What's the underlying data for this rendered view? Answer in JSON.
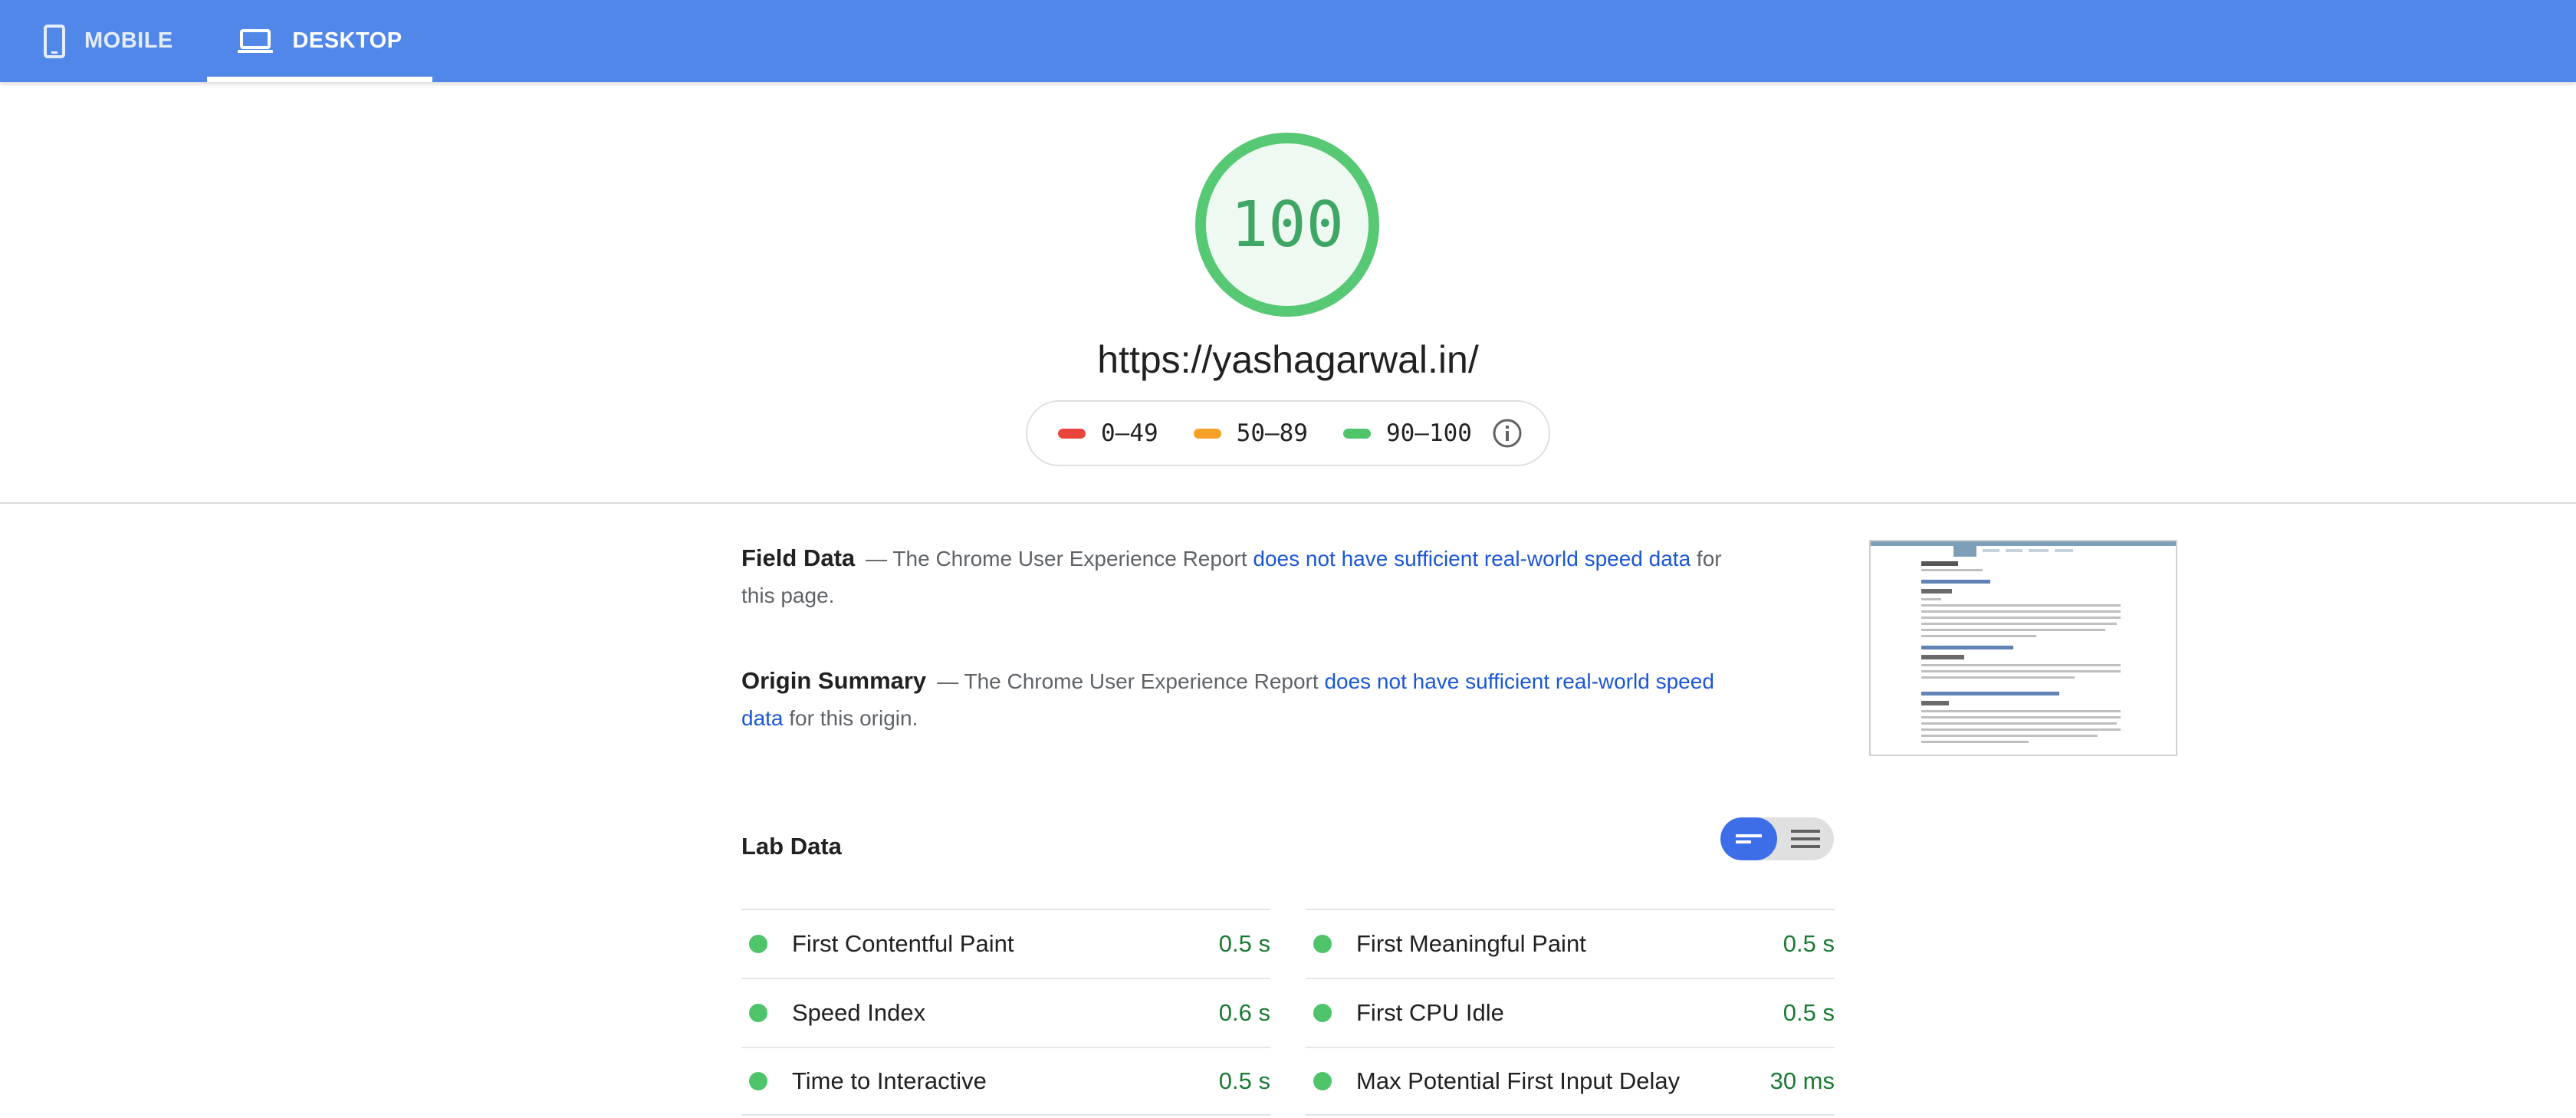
{
  "tabs": [
    {
      "label": "MOBILE",
      "icon": "smartphone-icon"
    },
    {
      "label": "DESKTOP",
      "icon": "laptop-icon",
      "selected": true
    }
  ],
  "score": {
    "value": "100",
    "color": "#0cce6b"
  },
  "url": "https://yashagarwal.in/",
  "legend": [
    {
      "label": "0–49",
      "color": "#e8453c"
    },
    {
      "label": "50–89",
      "color": "#f5a12a"
    },
    {
      "label": "90–100",
      "color": "#4fc46b"
    }
  ],
  "field_data": {
    "heading": "Field Data",
    "prefix": "— The Chrome User Experience Report ",
    "link": "does not have sufficient real-world speed data",
    "suffix": " for this page."
  },
  "origin_summary": {
    "heading": "Origin Summary",
    "prefix": "— The Chrome User Experience Report ",
    "link": "does not have sufficient real-world speed data",
    "suffix": " for this origin."
  },
  "lab_data": {
    "heading": "Lab Data",
    "left": [
      {
        "label": "First Contentful Paint",
        "value": "0.5 s"
      },
      {
        "label": "Speed Index",
        "value": "0.6 s"
      },
      {
        "label": "Time to Interactive",
        "value": "0.5 s"
      }
    ],
    "right": [
      {
        "label": "First Meaningful Paint",
        "value": "0.5 s"
      },
      {
        "label": "First CPU Idle",
        "value": "0.5 s"
      },
      {
        "label": "Max Potential First Input Delay",
        "value": "30 ms"
      }
    ]
  },
  "colors": {
    "topbar": "#5187e8",
    "pass": "#4fc46b",
    "link": "#1a56d6"
  }
}
